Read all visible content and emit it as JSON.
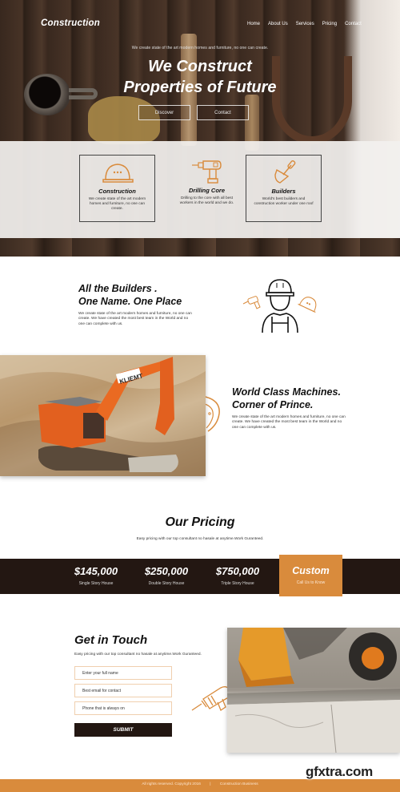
{
  "header": {
    "brand": "Construction",
    "nav": [
      "Home",
      "About Us",
      "Services",
      "Pricing",
      "Contact"
    ]
  },
  "hero": {
    "subtitle": "We create state of the art modern homes and furniture, no one can create.",
    "title_line1": "We Construct",
    "title_line2": "Properties of Future",
    "buttons": [
      "Discover",
      "Contact"
    ]
  },
  "features": [
    {
      "icon": "hard-hat-icon",
      "title": "Construction",
      "text": "We create state of the art modern homes and furniture, no one can create."
    },
    {
      "icon": "drill-icon",
      "title": "Drilling Core",
      "text": "Drilling to the core with all best workers in the world and we do."
    },
    {
      "icon": "trowel-icon",
      "title": "Builders",
      "text": "World's best builders and construction worker under one roof"
    }
  ],
  "builders_section": {
    "title_line1": "All the Builders .",
    "title_line2": "One Name. One Place",
    "text": "We create state of the art modern homes and furniture, no one can create. We have created the most best team in the World and no one can complete with us."
  },
  "machines_section": {
    "image_label": "KLIEMT",
    "title_line1": "World Class Machines.",
    "title_line2": "Corner of Prince.",
    "text": "We create state of the art modern homes and furniture, no one can create. We have created the most best team in the World and no one can complete with us."
  },
  "pricing": {
    "title": "Our Pricing",
    "subtitle": "Easy pricing with our top consultant no hasale at anytime.Work Guranteed.",
    "plans": [
      {
        "amount": "$145,000",
        "label": "Single Story House"
      },
      {
        "amount": "$250,000",
        "label": "Double Story House"
      },
      {
        "amount": "$750,000",
        "label": "Triple Story House"
      }
    ],
    "custom": {
      "amount": "Custom",
      "label": "Call Us to Know"
    }
  },
  "contact": {
    "title": "Get in Touch",
    "subtitle": "Easy pricing with our top consultant no hasale at anytime.Work Guranteed.",
    "fields": [
      {
        "placeholder": "Enter your full name",
        "value": ""
      },
      {
        "placeholder": "Best email for contact",
        "value": ""
      },
      {
        "placeholder": "Phone that is always on",
        "value": ""
      }
    ],
    "submit": "SUBMIT"
  },
  "footer": {
    "copyright": "All rights reserved. Copyright 2016",
    "separator": "|",
    "company": "Construction Business"
  },
  "watermark": "gfxtra.com",
  "colors": {
    "accent": "#d98b3c",
    "dark": "#231712"
  }
}
